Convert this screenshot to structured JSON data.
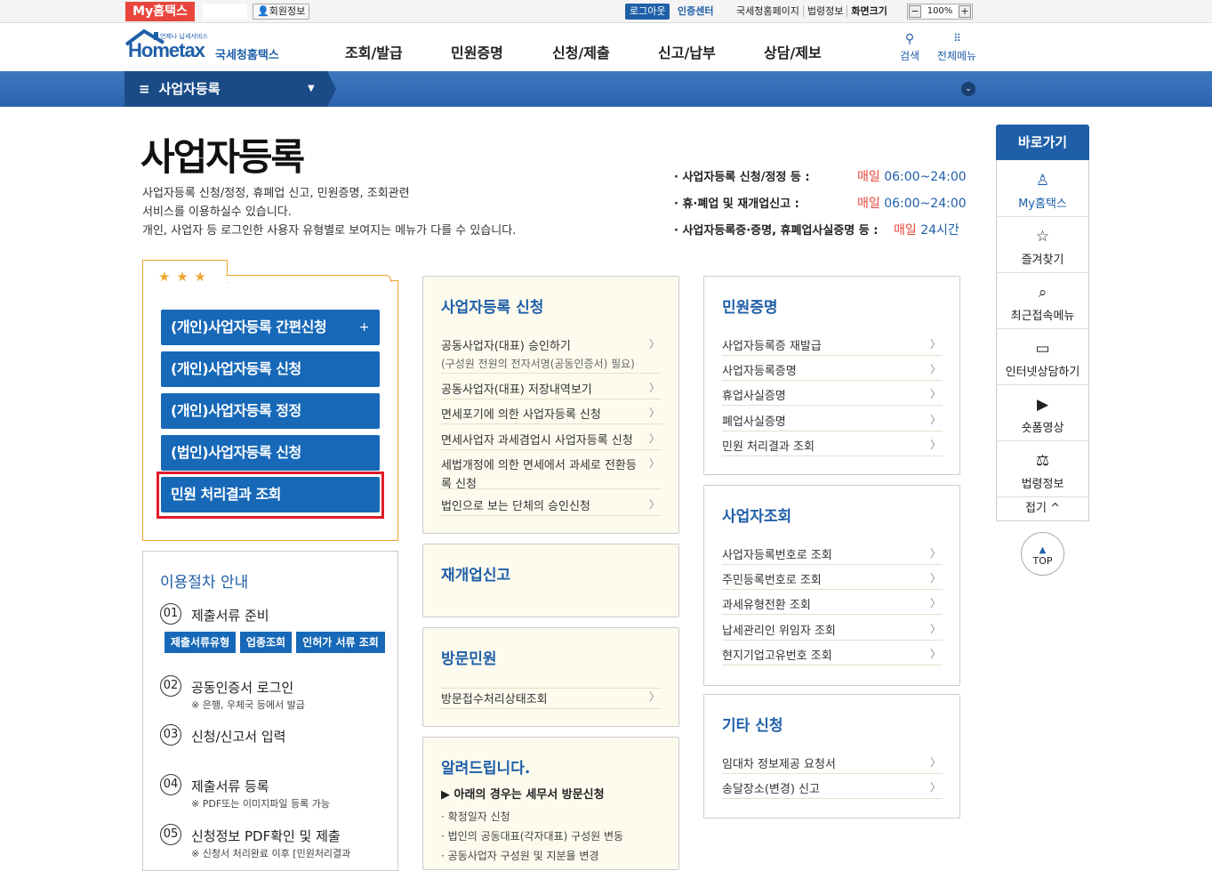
{
  "util": {
    "my_hometax": "My홈택스",
    "member_info": "회원정보",
    "logout": "로그아웃",
    "cert_center": "인증센터",
    "links": [
      "국세청홈페이지",
      "법령정보",
      "화면크기"
    ],
    "zoom": "100%"
  },
  "header": {
    "logo_small": "언제나 납세서비스",
    "logo_main": "Hometax",
    "logo_sub": "국세청홈택스",
    "gnb": [
      "조회/발급",
      "민원증명",
      "신청/제출",
      "신고/납부",
      "상담/제보"
    ],
    "search": "검색",
    "all_menu": "전체메뉴"
  },
  "nav": {
    "current": "사업자등록"
  },
  "page": {
    "title": "사업자등록",
    "desc": [
      "사업자등록 신청/정정, 휴폐업 신고, 민원증명, 조회관련",
      "서비스를 이용하실수 있습니다.",
      "개인, 사업자 등 로그인한 사용자 유형별로 보여지는 메뉴가 다를 수 있습니다."
    ],
    "hours": [
      {
        "label": "· 사업자등록 신청/정정 등 :",
        "daily": "매일",
        "time": "06:00~24:00"
      },
      {
        "label": "· 휴·폐업 및 재개업신고 :",
        "daily": "매일",
        "time": "06:00~24:00"
      },
      {
        "label": "· 사업자등록증·증명, 휴폐업사실증명 등 :",
        "daily": "매일",
        "time": "24시간"
      }
    ]
  },
  "fav": {
    "stars": "★ ★ ★",
    "buttons": [
      "(개인)사업자등록 간편신청",
      "(개인)사업자등록 신청",
      "(개인)사업자등록 정정",
      "(법인)사업자등록 신청",
      "민원 처리결과 조회"
    ],
    "plus": "+"
  },
  "guide": {
    "title": "이용절차 안내",
    "steps": [
      {
        "n": "01",
        "t": "제출서류 준비",
        "s": ""
      },
      {
        "n": "02",
        "t": "공동인증서 로그인",
        "s": "※ 은행, 우체국 등에서 발급"
      },
      {
        "n": "03",
        "t": "신청/신고서 입력",
        "s": ""
      },
      {
        "n": "04",
        "t": "제출서류 등록",
        "s": "※ PDF또는 이미지파일 등록 가능"
      },
      {
        "n": "05",
        "t": "신청정보 PDF확인 및 제출",
        "s": "※ 신청서 처리완료 이후 [민원처리결과"
      }
    ],
    "buttons": [
      "제출서류유형",
      "업종조회",
      "인허가 서류 조회"
    ]
  },
  "panels": {
    "apply": {
      "title": "사업자등록 신청",
      "items": [
        "공동사업자(대표) 승인하기",
        "공동사업자(대표) 저장내역보기",
        "면세포기에 의한 사업자등록 신청",
        "면세사업자 과세겸업시 사업자등록 신청",
        "세법개정에 의한 면세에서 과세로 전환등",
        "법인으로 보는 단체의 승인신청"
      ],
      "item1_note": "(구성원 전원의 전자서명(공동인증서) 필요)",
      "item5_cont": "록 신청"
    },
    "reopen": {
      "title": "재개업신고"
    },
    "visit": {
      "title": "방문민원",
      "items": [
        "방문접수처리상태조회"
      ]
    },
    "notice": {
      "title": "알려드립니다.",
      "lead": "▶ 아래의 경우는 세무서 방문신청",
      "items": [
        "확정일자 신청",
        "법인의 공동대표(각자대표) 구성원 변동",
        "공동사업자 구성원 및 지분율 변경"
      ]
    },
    "cert": {
      "title": "민원증명",
      "items": [
        "사업자등록증 재발급",
        "사업자등록증명",
        "휴업사실증명",
        "폐업사실증명",
        "민원 처리결과 조회"
      ]
    },
    "lookup": {
      "title": "사업자조회",
      "items": [
        "사업자등록번호로 조회",
        "주민등록번호로 조회",
        "과세유형전환 조회",
        "납세관리인 위임자 조회",
        "현지기업고유번호 조회"
      ]
    },
    "etc": {
      "title": "기타 신청",
      "items": [
        "임대차 정보제공 요청서",
        "송달장소(변경) 신고"
      ]
    }
  },
  "quick": {
    "title": "바로가기",
    "items": [
      "My홈택스",
      "즐겨찾기",
      "최근접속메뉴",
      "인터넷상담하기",
      "숏폼영상",
      "법령정보"
    ],
    "fold": "접기 ^",
    "top": "TOP"
  },
  "colors": {
    "primary": "#1769b8",
    "accent": "#e8463d",
    "highlight": "#e01c2b",
    "favborder": "#f0a531"
  }
}
